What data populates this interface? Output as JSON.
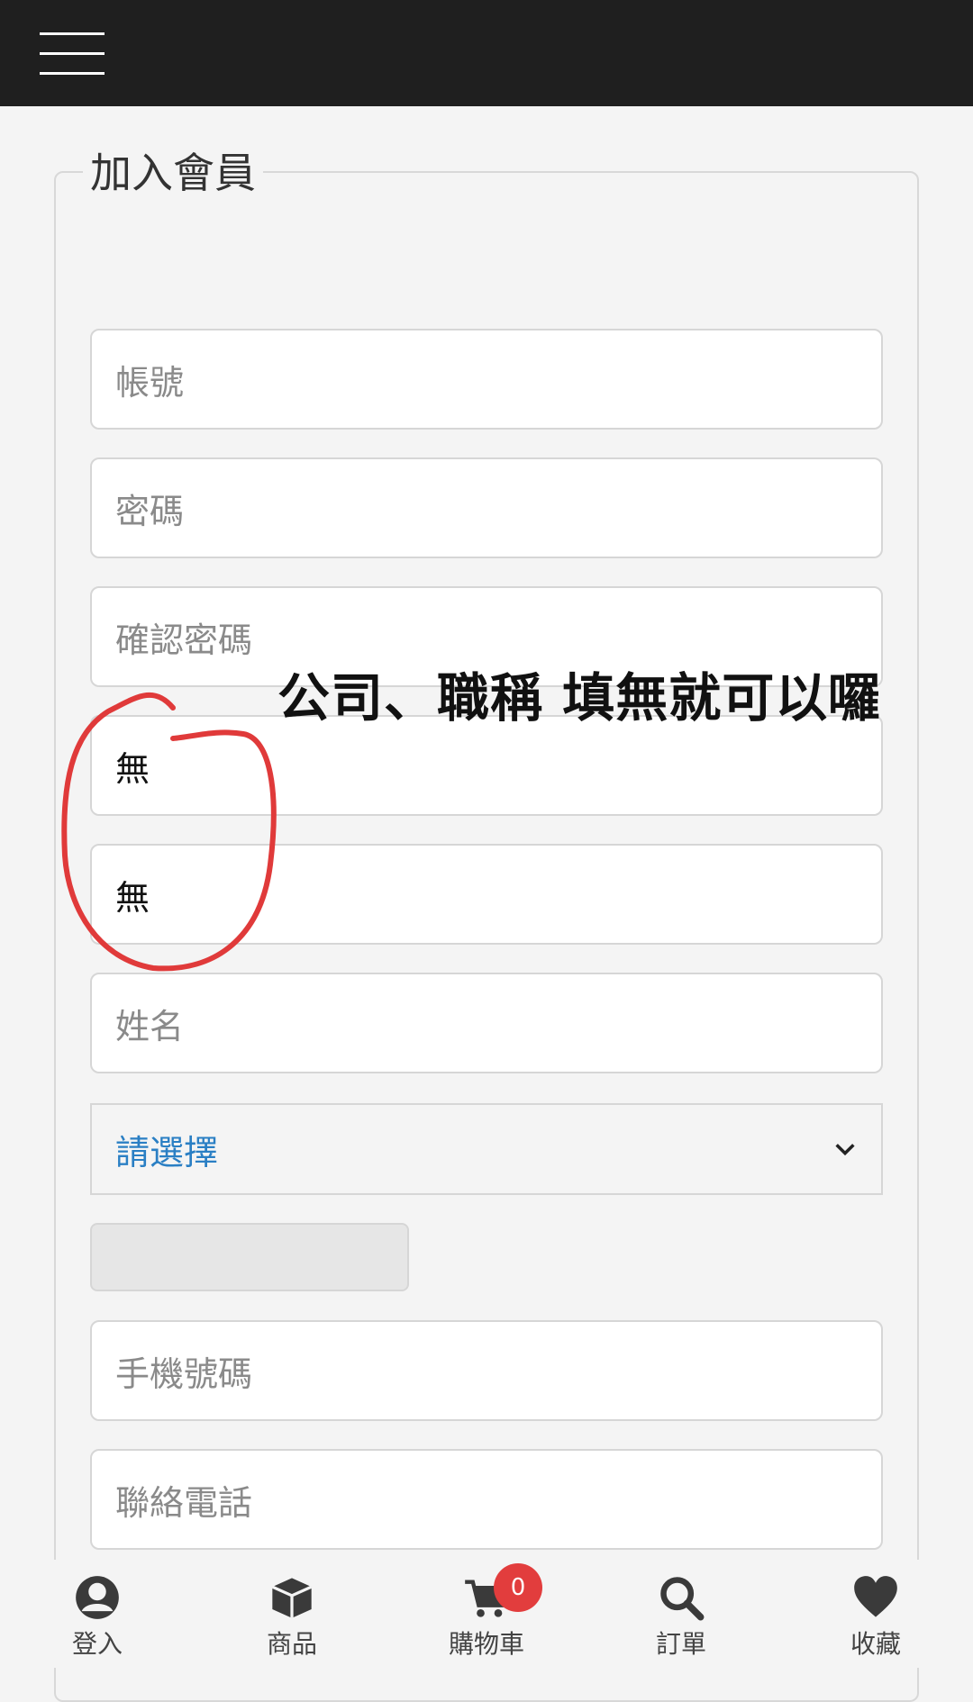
{
  "header": {
    "menu_icon": "hamburger-icon"
  },
  "form": {
    "legend": "加入會員",
    "fields": [
      {
        "placeholder": "帳號",
        "value": ""
      },
      {
        "placeholder": "密碼",
        "value": ""
      },
      {
        "placeholder": "確認密碼",
        "value": ""
      },
      {
        "placeholder": "",
        "value": "無"
      },
      {
        "placeholder": "",
        "value": "無"
      },
      {
        "placeholder": "姓名",
        "value": ""
      },
      {
        "placeholder": "手機號碼",
        "value": ""
      },
      {
        "placeholder": "聯絡電話",
        "value": ""
      }
    ],
    "select": {
      "selected": "請選擇",
      "icon": "chevron-down-icon"
    }
  },
  "annotation": {
    "note": "公司、職稱 填無就可以囉",
    "circle_color": "#e03a3a"
  },
  "bottom_nav": [
    {
      "label": "登入",
      "icon": "user-icon"
    },
    {
      "label": "商品",
      "icon": "box-icon"
    },
    {
      "label": "購物車",
      "icon": "cart-icon",
      "badge": "0"
    },
    {
      "label": "訂單",
      "icon": "search-icon"
    },
    {
      "label": "收藏",
      "icon": "heart-icon"
    }
  ]
}
